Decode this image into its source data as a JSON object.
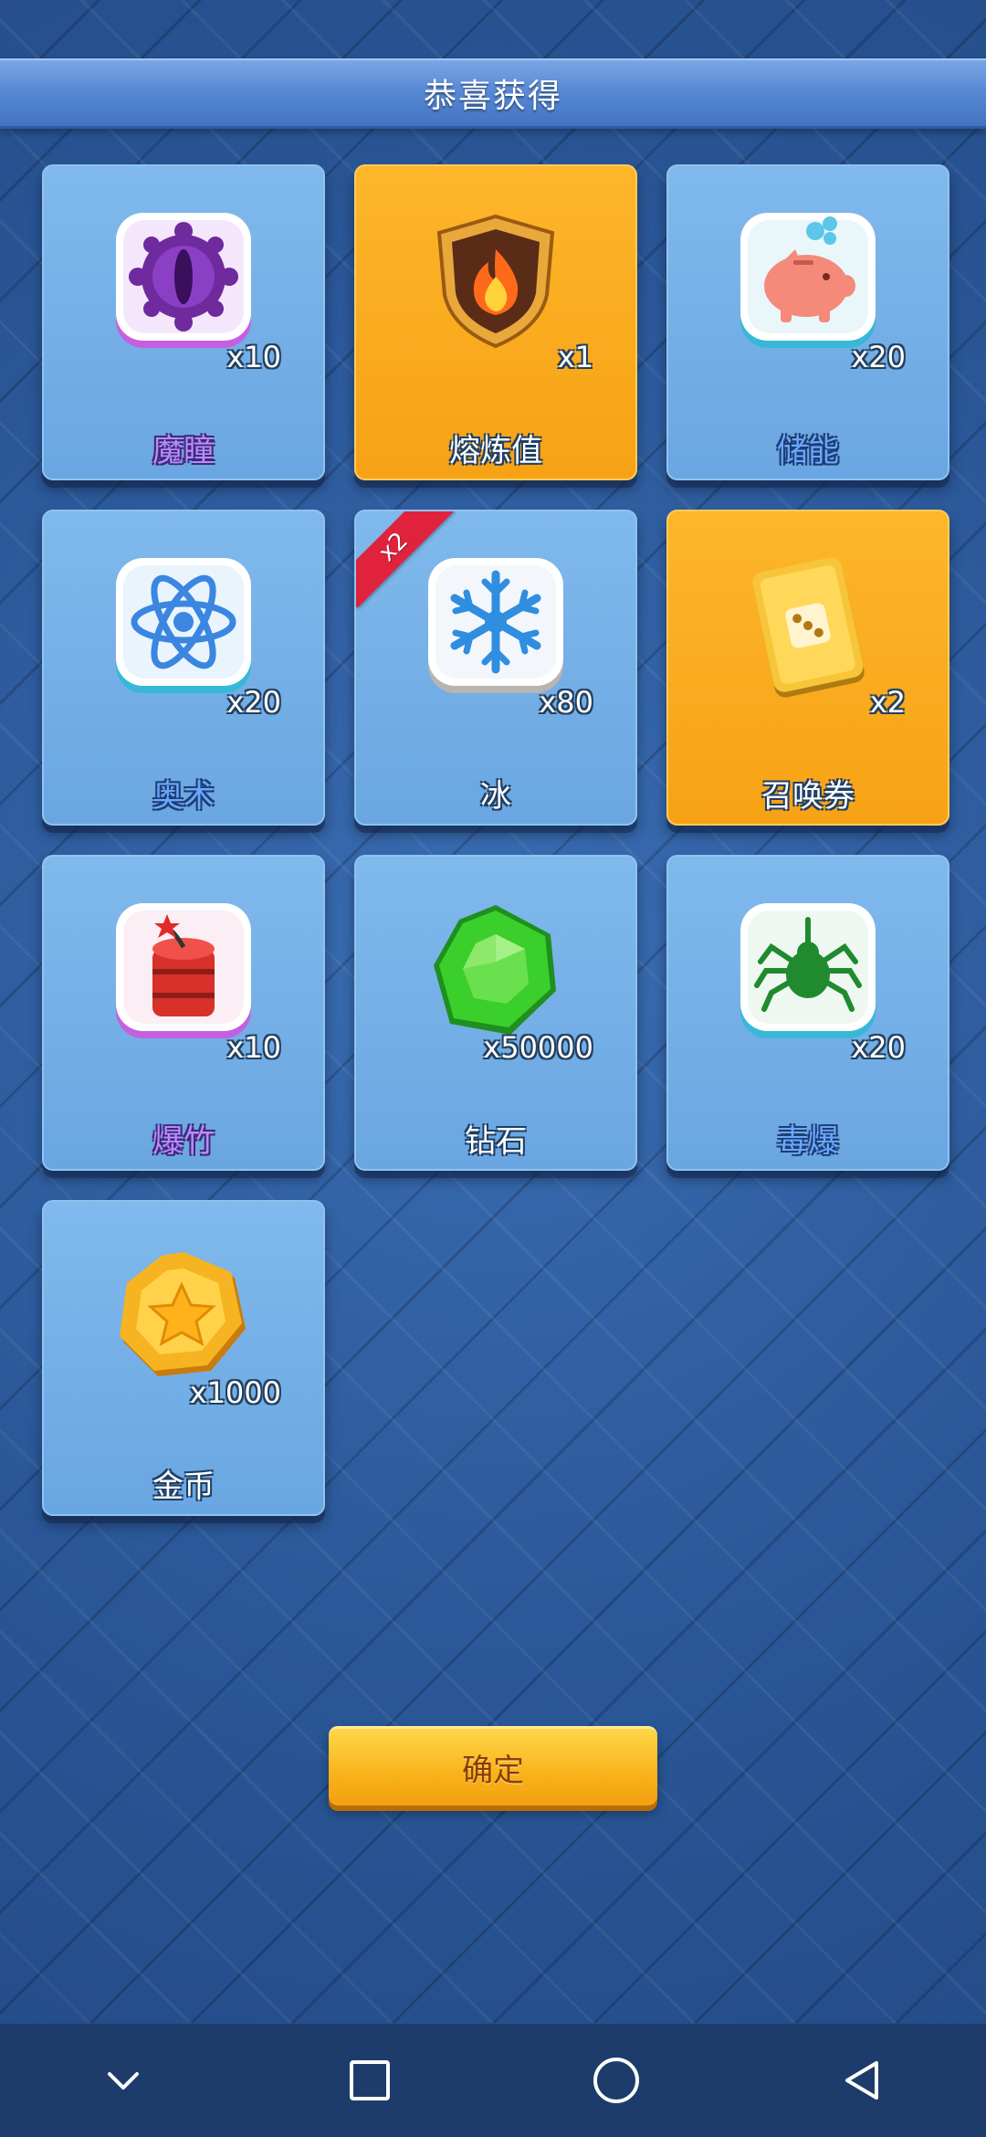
{
  "title": "恭喜获得",
  "items": [
    {
      "name": "魔瞳",
      "qty": "x10",
      "icon": "purple-eye-icon",
      "bg": "blue",
      "label_color": "purple"
    },
    {
      "name": "熔炼值",
      "qty": "x1",
      "icon": "fire-shield-icon",
      "bg": "gold",
      "label_color": "white"
    },
    {
      "name": "储能",
      "qty": "x20",
      "icon": "piggy-bank-icon",
      "bg": "blue",
      "label_color": "blue"
    },
    {
      "name": "奥术",
      "qty": "x20",
      "icon": "atom-icon",
      "bg": "blue",
      "label_color": "blue"
    },
    {
      "name": "冰",
      "qty": "x80",
      "icon": "snowflake-icon",
      "bg": "blue",
      "label_color": "white",
      "bonus": "x2"
    },
    {
      "name": "召唤券",
      "qty": "x2",
      "icon": "dice-card-icon",
      "bg": "gold",
      "label_color": "white"
    },
    {
      "name": "爆竹",
      "qty": "x10",
      "icon": "firecracker-icon",
      "bg": "blue",
      "label_color": "purple"
    },
    {
      "name": "钻石",
      "qty": "x50000",
      "icon": "green-gem-icon",
      "bg": "blue",
      "label_color": "white"
    },
    {
      "name": "毒爆",
      "qty": "x20",
      "icon": "spider-icon",
      "bg": "blue",
      "label_color": "blue"
    },
    {
      "name": "金币",
      "qty": "x1000",
      "icon": "gold-coin-icon",
      "bg": "blue",
      "label_color": "white"
    }
  ],
  "confirm_label": "确定",
  "navbar": {
    "buttons": [
      "chevron-down-icon",
      "square-icon",
      "circle-icon",
      "back-triangle-icon"
    ]
  },
  "colors": {
    "background": "#2a5798",
    "card_blue": "#74afe6",
    "card_gold": "#f9a91d",
    "button_gold": "#f9b21a",
    "bonus_red": "#e0223d"
  }
}
